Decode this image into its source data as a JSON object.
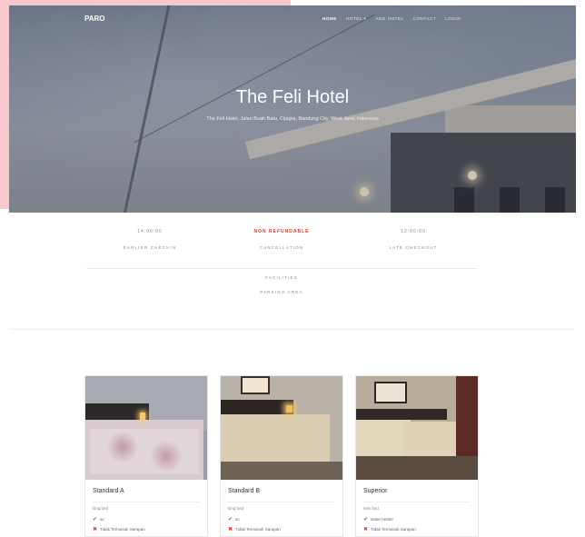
{
  "brand": "PARO",
  "nav": [
    "HOME",
    "HOTEL ▾",
    "ADD HOTEL",
    "CONTACT",
    "LOGIN"
  ],
  "hero": {
    "title": "The Feli Hotel",
    "subtitle": "The Feli Hotel, Jalan Buah Batu, Cijagra, Bandung City, West Java, Indonesia"
  },
  "info": [
    {
      "value": "14:00:00",
      "label": "EARLIER CHECKIN",
      "highlight": false
    },
    {
      "value": "NON REFUNDABLE",
      "label": "CANCELLATION",
      "highlight": true
    },
    {
      "value": "12:00:00",
      "label": "LATE CHECKOUT",
      "highlight": false
    }
  ],
  "facilities_label": "FACILITIES",
  "parking_label": "PARKING AREA",
  "rooms": [
    {
      "name": "Standard A",
      "bed": "king bed",
      "feature_ok": "ac",
      "feature_no": "Tidak Termasuk Sarapan"
    },
    {
      "name": "Standard B",
      "bed": "king bed",
      "feature_ok": "ac",
      "feature_no": "Tidak Termasuk Sarapan"
    },
    {
      "name": "Superior",
      "bed": "twin bed",
      "feature_ok": "water heater",
      "feature_no": "Tidak Termasuk Sarapan"
    }
  ],
  "colors": {
    "accent_red": "#d03a2c",
    "check_green": "#2f9e41",
    "pink_bg": "#f8c8cc"
  }
}
